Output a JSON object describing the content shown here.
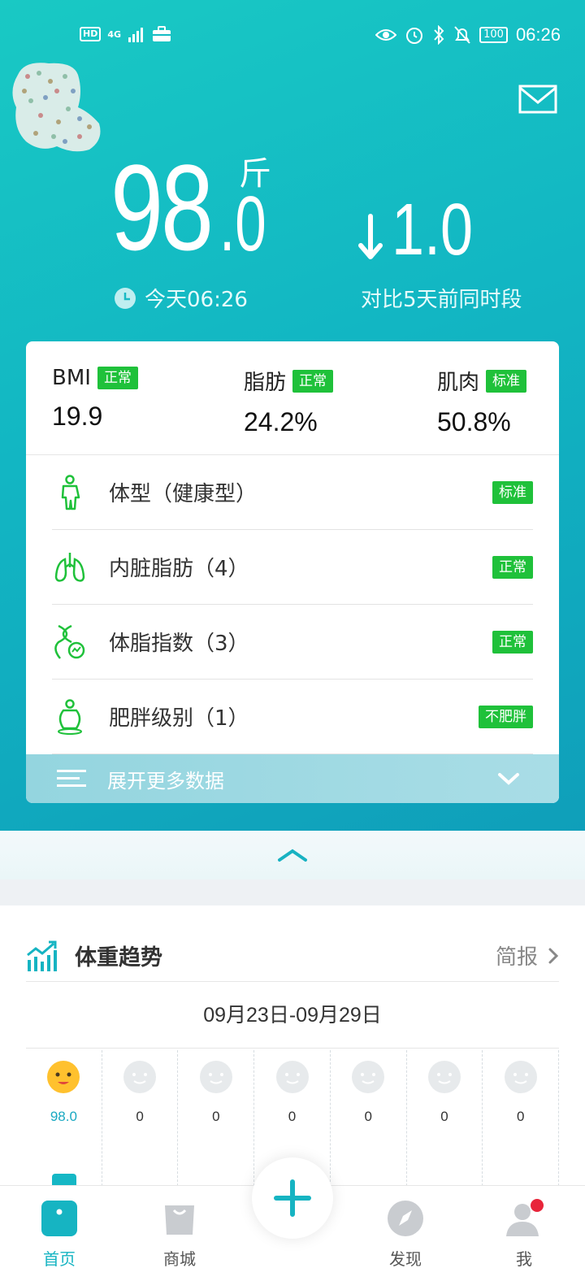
{
  "status_bar": {
    "hd": "HD",
    "network": "4G",
    "battery": "100",
    "time": "06:26"
  },
  "hero": {
    "weight_integer": "98",
    "weight_decimal": ".0",
    "weight_unit": "斤",
    "measure_time": "今天06:26",
    "change_value": "1.0",
    "change_label": "对比5天前同时段"
  },
  "metrics": [
    {
      "label": "BMI",
      "tag": "正常",
      "value": "19.9"
    },
    {
      "label": "脂肪",
      "tag": "正常",
      "value": "24.2%"
    },
    {
      "label": "肌肉",
      "tag": "标准",
      "value": "50.8%"
    }
  ],
  "rows": [
    {
      "label": "体型（健康型）",
      "tag": "标准",
      "icon": "body-icon"
    },
    {
      "label": "内脏脂肪（4）",
      "tag": "正常",
      "icon": "lungs-icon"
    },
    {
      "label": "体脂指数（3）",
      "tag": "正常",
      "icon": "dna-icon"
    },
    {
      "label": "肥胖级别（1）",
      "tag": "不肥胖",
      "icon": "fat-body-icon"
    }
  ],
  "expand": {
    "label": "展开更多数据"
  },
  "trend": {
    "title": "体重趋势",
    "brief": "简报",
    "range": "09月23日-09月29日",
    "days": [
      "98.0",
      "0",
      "0",
      "0",
      "0",
      "0",
      "0"
    ]
  },
  "tabs": [
    {
      "label": "首页",
      "icon": "home-icon",
      "active": true
    },
    {
      "label": "商城",
      "icon": "shop-bag-icon",
      "active": false
    },
    {
      "label": "发现",
      "icon": "compass-icon",
      "active": false
    },
    {
      "label": "我",
      "icon": "profile-icon",
      "active": false
    }
  ],
  "colors": {
    "accent": "#16b4c2",
    "tag_green": "#1fc13a",
    "notification": "#e8253a"
  }
}
